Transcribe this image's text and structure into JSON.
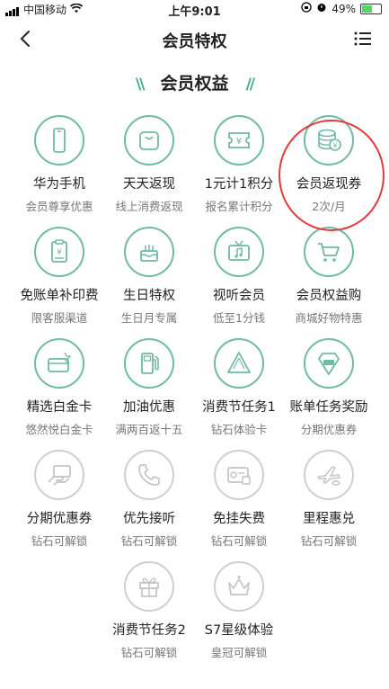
{
  "status": {
    "carrier": "中国移动",
    "time": "上午9:01",
    "battery": "49%"
  },
  "header": {
    "title": "会员特权"
  },
  "section": {
    "title": "会员权益",
    "deco_left": "\\\\",
    "deco_right": "//"
  },
  "benefits": [
    {
      "name": "华为手机",
      "desc": "会员尊享优惠",
      "icon": "phone-icon"
    },
    {
      "name": "天天返现",
      "desc": "线上消费返现",
      "icon": "shopping-bag-icon"
    },
    {
      "name": "1元计1积分",
      "desc": "报名累计积分",
      "icon": "yen-ticket-icon"
    },
    {
      "name": "会员返现券",
      "desc": "2次/月",
      "icon": "coin-stack-icon"
    },
    {
      "name": "免账单补印费",
      "desc": "限客服渠道",
      "icon": "bill-icon"
    },
    {
      "name": "生日特权",
      "desc": "生日月专属",
      "icon": "birthday-cake-icon"
    },
    {
      "name": "视听会员",
      "desc": "低至1分钱",
      "icon": "tv-music-icon"
    },
    {
      "name": "会员权益购",
      "desc": "商城好物特惠",
      "icon": "cart-icon"
    },
    {
      "name": "精选白金卡",
      "desc": "悠然悦白金卡",
      "icon": "platinum-card-icon"
    },
    {
      "name": "加油优惠",
      "desc": "满两百返十五",
      "icon": "fuel-pump-icon"
    },
    {
      "name": "消费节任务1",
      "desc": "钻石体验卡",
      "icon": "pass-icon"
    },
    {
      "name": "账单任务奖励",
      "desc": "分期优惠券",
      "icon": "vip-card-icon"
    },
    {
      "name": "分期优惠券",
      "desc": "钻石可解锁",
      "icon": "hand-card-icon"
    },
    {
      "name": "优先接听",
      "desc": "钻石可解锁",
      "icon": "phone-call-icon"
    },
    {
      "name": "免挂失费",
      "desc": "钻石可解锁",
      "icon": "lost-card-icon"
    },
    {
      "name": "里程惠兑",
      "desc": "钻石可解锁",
      "icon": "airplane-icon"
    },
    {
      "name": "消费节任务2",
      "desc": "钻石可解锁",
      "icon": "gift-icon"
    },
    {
      "name": "S7星级体验",
      "desc": "皇冠可解锁",
      "icon": "crown-icon"
    }
  ],
  "colors": {
    "accent": "#3fae8e",
    "icon_stroke": "#6fbaa4",
    "locked": "#c4c4c4",
    "highlight": "#e23b3b"
  }
}
